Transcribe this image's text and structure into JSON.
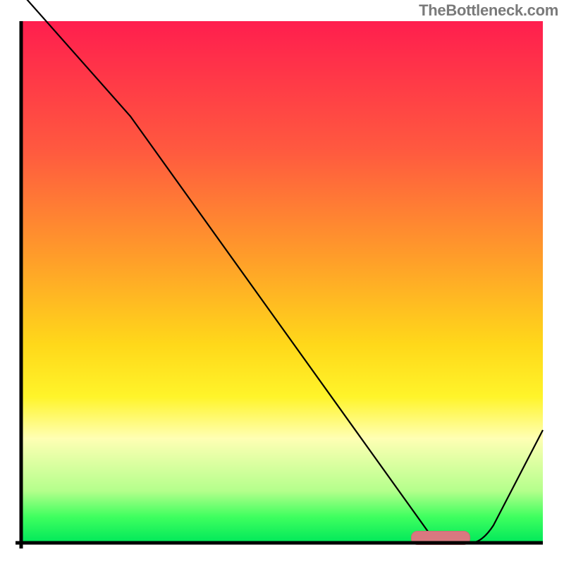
{
  "watermark": "TheBottleneck.com",
  "colors": {
    "gradient_top": "#ff1e4e",
    "gradient_bottom": "#00e85a",
    "curve_stroke": "#000000",
    "marker_fill": "#d97880"
  },
  "chart_data": {
    "type": "line",
    "title": "",
    "xlabel": "",
    "ylabel": "",
    "xlim": [
      0,
      100
    ],
    "ylim": [
      0,
      100
    ],
    "x": [
      0,
      20,
      78,
      86,
      100
    ],
    "values": [
      105,
      82,
      0,
      0,
      22
    ],
    "annotations": [
      {
        "kind": "highlight-range",
        "x_start": 75,
        "x_end": 86,
        "y": 0.5
      }
    ],
    "grid": false,
    "legend_position": "none",
    "background": "heatmap-gradient-vertical"
  }
}
